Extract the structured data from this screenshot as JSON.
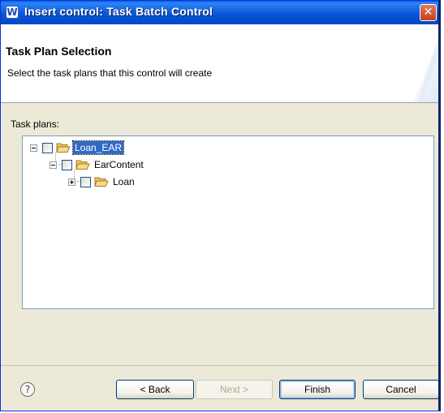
{
  "window": {
    "title": "Insert control:  Task Batch Control",
    "app_icon": "w-icon",
    "close_label": "✕"
  },
  "header": {
    "title": "Task Plan Selection",
    "description": "Select the task plans that this control will create"
  },
  "tree": {
    "label": "Task plans:",
    "nodes": [
      {
        "label": "Loan_EAR",
        "expanded": true,
        "checked": false,
        "selected": true,
        "level": 0
      },
      {
        "label": "EarContent",
        "expanded": true,
        "checked": false,
        "selected": false,
        "level": 1
      },
      {
        "label": "Loan",
        "expanded": false,
        "checked": false,
        "selected": false,
        "level": 2
      }
    ]
  },
  "footer": {
    "help_label": "?",
    "back_label": "< Back",
    "next_label": "Next >",
    "finish_label": "Finish",
    "cancel_label": "Cancel"
  },
  "colors": {
    "titlebar": "#0a56d6",
    "selection": "#316ac5",
    "dialog_bg": "#ece9d8"
  }
}
